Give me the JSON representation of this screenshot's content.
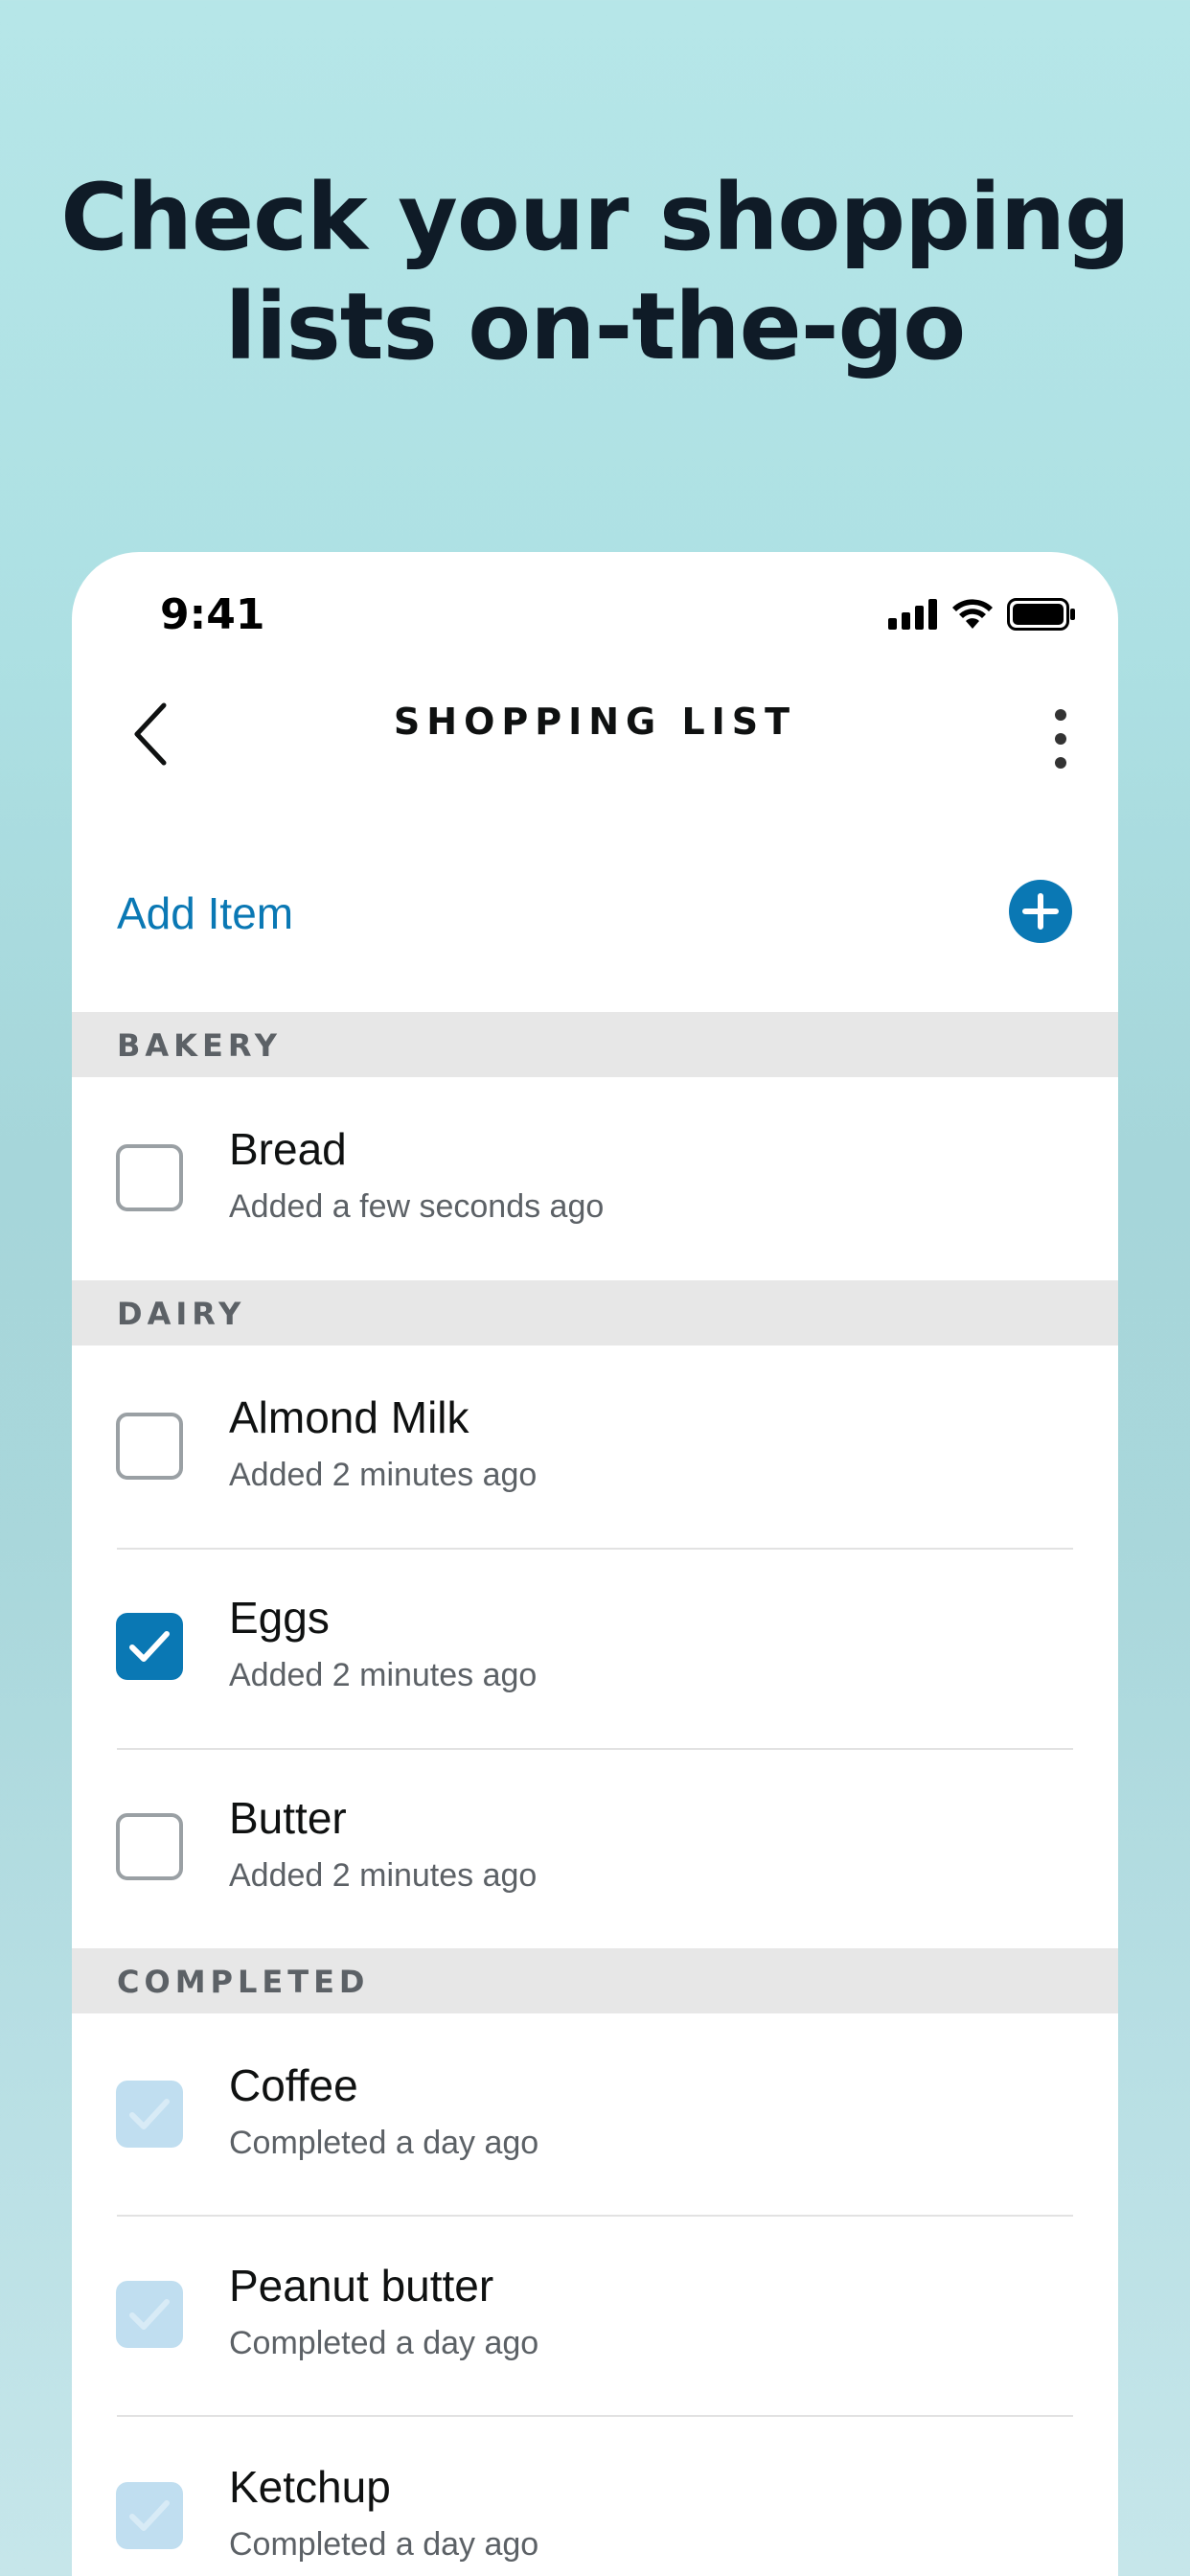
{
  "headline": {
    "line1": "Check your shopping",
    "line2": "lists on-the-go"
  },
  "status_bar": {
    "time": "9:41",
    "icons": [
      "signal-icon",
      "wifi-icon",
      "battery-icon"
    ]
  },
  "nav": {
    "title": "SHOPPING LIST",
    "back_icon": "chevron-left-icon",
    "more_icon": "more-vertical-icon"
  },
  "add_item": {
    "label": "Add Item",
    "icon": "plus-circle-icon"
  },
  "sections": [
    {
      "label": "BAKERY",
      "items": [
        {
          "name": "Bread",
          "sub": "Added a few seconds ago",
          "state": "unchecked"
        }
      ]
    },
    {
      "label": "DAIRY",
      "items": [
        {
          "name": "Almond Milk",
          "sub": "Added 2 minutes ago",
          "state": "unchecked"
        },
        {
          "name": "Eggs",
          "sub": "Added 2 minutes ago",
          "state": "checked"
        },
        {
          "name": "Butter",
          "sub": "Added 2 minutes ago",
          "state": "unchecked"
        }
      ]
    },
    {
      "label": "COMPLETED",
      "items": [
        {
          "name": "Coffee",
          "sub": "Completed a day ago",
          "state": "completed"
        },
        {
          "name": "Peanut butter",
          "sub": "Completed a day ago",
          "state": "completed"
        },
        {
          "name": "Ketchup",
          "sub": "Completed a day ago",
          "state": "completed"
        }
      ]
    }
  ],
  "colors": {
    "accent": "#0a78b4",
    "completed_check": "#c0def0",
    "section_bg": "#e7e7e7"
  }
}
